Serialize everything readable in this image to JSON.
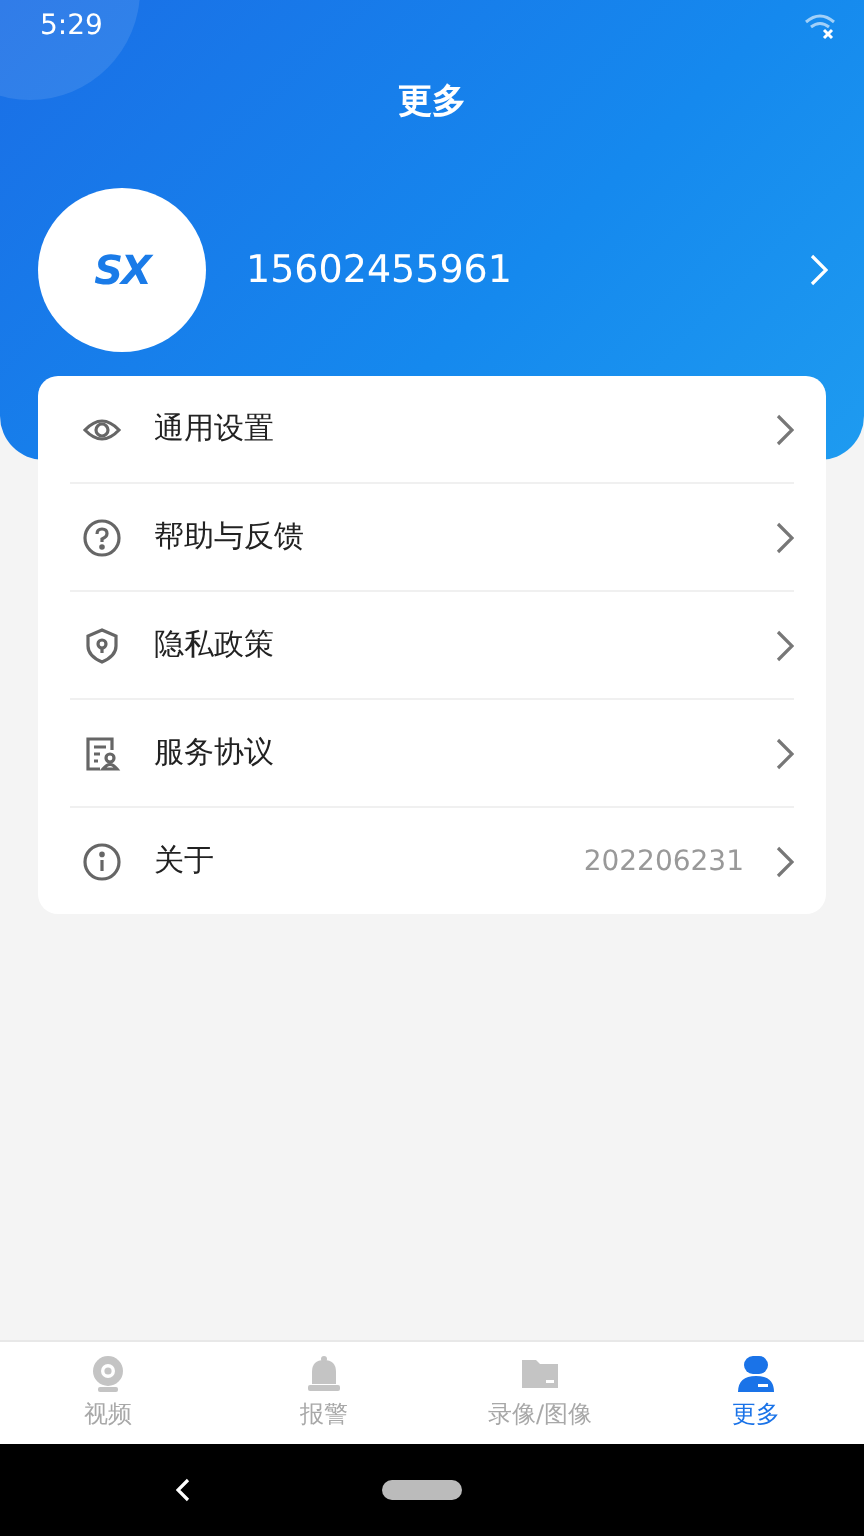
{
  "status_bar": {
    "time": "5:29"
  },
  "header": {
    "title": "更多"
  },
  "profile": {
    "logo": "SX",
    "phone": "15602455961"
  },
  "menu": [
    {
      "kind": "eye",
      "label": "通用设置"
    },
    {
      "kind": "help",
      "label": "帮助与反馈"
    },
    {
      "kind": "shield",
      "label": "隐私政策"
    },
    {
      "kind": "document",
      "label": "服务协议"
    },
    {
      "kind": "info",
      "label": "关于",
      "value": "202206231"
    }
  ],
  "tabs": [
    {
      "kind": "camera",
      "label": "视频",
      "selected": false
    },
    {
      "kind": "bell",
      "label": "报警",
      "selected": false
    },
    {
      "kind": "folder",
      "label": "录像/图像",
      "selected": false
    },
    {
      "kind": "user",
      "label": "更多",
      "selected": true
    }
  ]
}
